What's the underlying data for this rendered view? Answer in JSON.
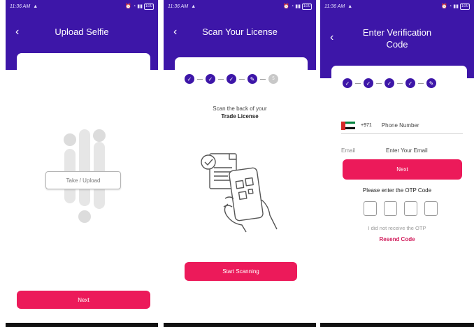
{
  "status_bar": {
    "time": "11:36 AM",
    "battery": "100"
  },
  "colors": {
    "header": "#3d16a8",
    "accent": "#ec1a5a",
    "link": "#d11a5a"
  },
  "screen1": {
    "title": "Upload Selfie",
    "upload_label": "Take / Upload",
    "next_label": "Next"
  },
  "screen2": {
    "title": "Scan Your License",
    "steps": [
      "done",
      "done",
      "done",
      "edit",
      "5"
    ],
    "instruction_line1": "Scan the back of your",
    "instruction_line2": "Trade License",
    "start_label": "Start Scanning"
  },
  "screen3": {
    "title_line1": "Enter Verification",
    "title_line2": "Code",
    "country_code": "+971",
    "phone_placeholder": "Phone Number",
    "email_label": "Email",
    "email_placeholder": "Enter Your Email",
    "next_label": "Next",
    "otp_prompt": "Please enter the OTP Code",
    "no_otp_text": "I did not receive the OTP",
    "resend_label": "Resend Code"
  }
}
